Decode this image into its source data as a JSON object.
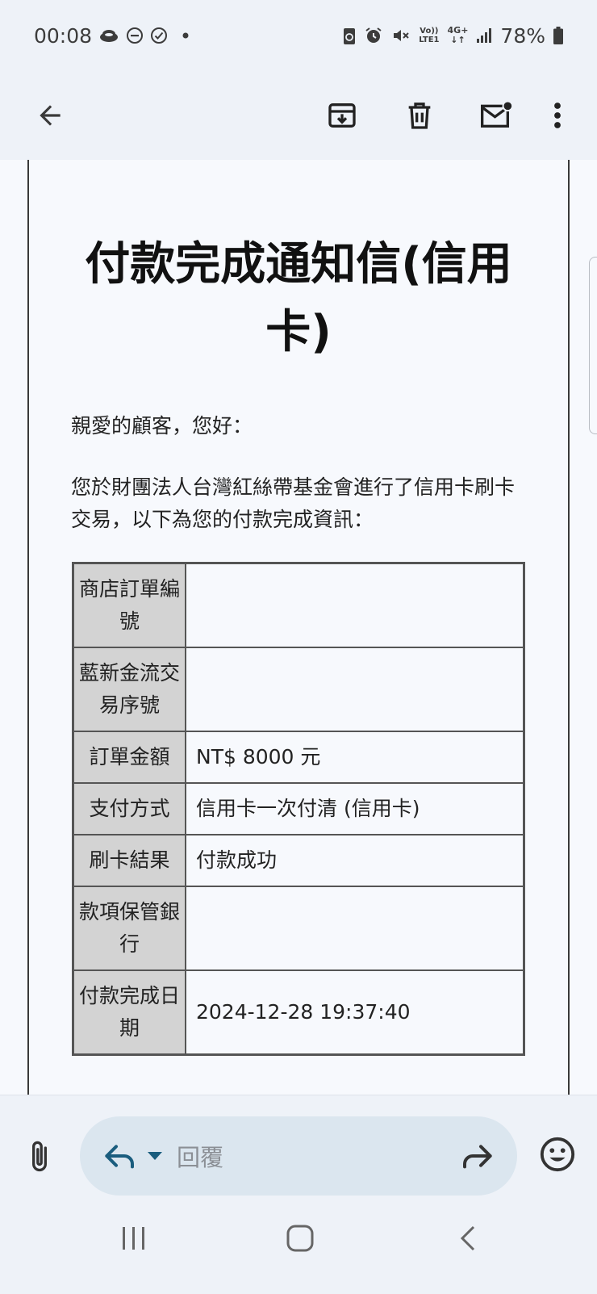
{
  "status_bar": {
    "time": "00:08",
    "battery": "78%",
    "network": "4G+",
    "volte_top": "Vo))",
    "volte_bottom": "LTE1"
  },
  "email": {
    "title": "付款完成通知信(信用卡)",
    "greeting": "親愛的顧客，您好：",
    "intro": "您於財團法人台灣紅絲帶基金會進行了信用卡刷卡交易，以下為您的付款完成資訊：",
    "table": [
      {
        "label": "商店訂單編號",
        "value": ""
      },
      {
        "label": "藍新金流交易序號",
        "value": ""
      },
      {
        "label": "訂單金額",
        "value": "NT$ 8000 元"
      },
      {
        "label": "支付方式",
        "value": "信用卡一次付清 (信用卡)"
      },
      {
        "label": "刷卡結果",
        "value": "付款成功"
      },
      {
        "label": "款項保管銀行",
        "value": ""
      },
      {
        "label": "付款完成日期",
        "value": "2024-12-28 19:37:40"
      }
    ]
  },
  "reply": {
    "placeholder": "回覆"
  },
  "icons": {
    "back": "arrow-left-icon",
    "archive": "archive-icon",
    "delete": "trash-icon",
    "unread": "mail-unread-icon",
    "more": "more-vert-icon",
    "attach": "paperclip-icon",
    "reply": "reply-icon",
    "dropdown": "caret-down-icon",
    "forward": "forward-icon",
    "emoji": "emoji-icon"
  },
  "colors": {
    "background": "#eef2f8",
    "reply_pill": "#dbe6ef",
    "reply_accent": "#1a5d7e",
    "table_header": "#d3d3d3"
  }
}
